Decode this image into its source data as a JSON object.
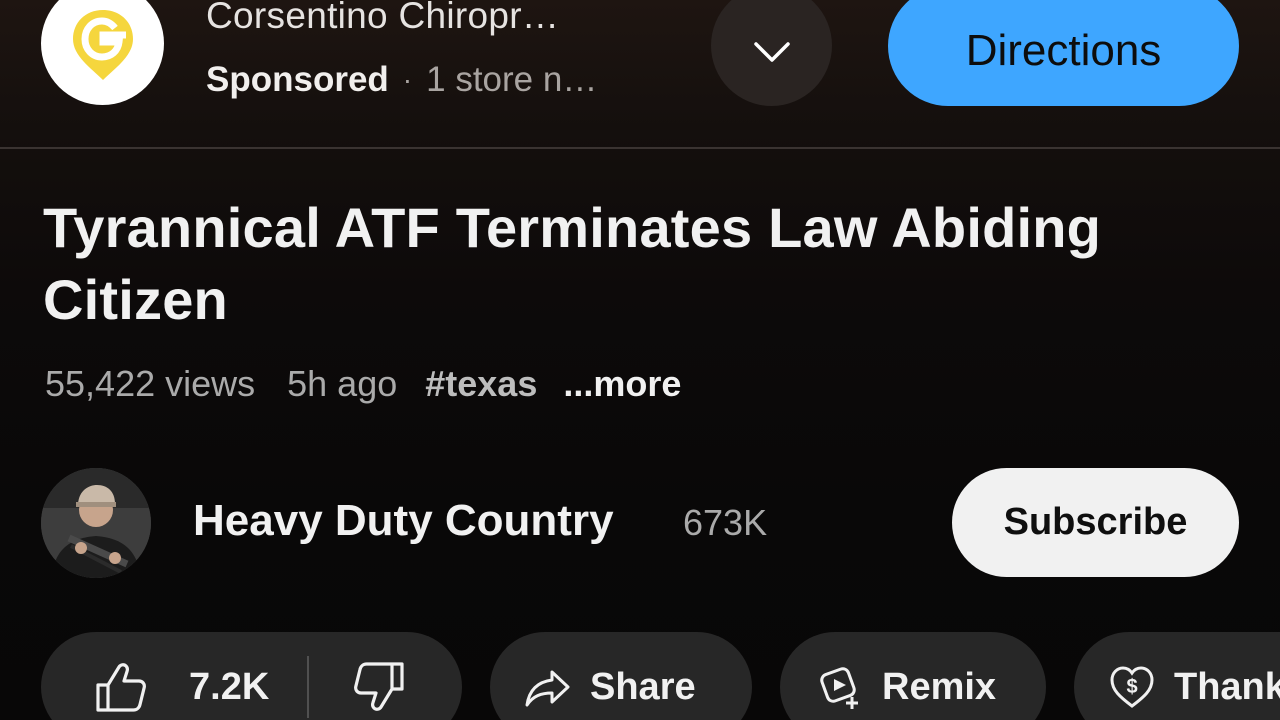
{
  "ad": {
    "title": "Corsentino Chiropr…",
    "sponsored": "Sponsored",
    "separator": "·",
    "store_info": "1 store n…",
    "directions_label": "Directions",
    "logo_icon": "location-pin-g-logo",
    "logo_color": "#f5d63d",
    "directions_color": "#3ea6ff"
  },
  "video": {
    "title": "Tyrannical ATF Terminates Law Abiding Citizen",
    "views": "55,422 views",
    "time": "5h ago",
    "hashtag": "#texas",
    "more": "...more"
  },
  "channel": {
    "name": "Heavy Duty Country",
    "subscribers": "673K",
    "subscribe_label": "Subscribe"
  },
  "actions": {
    "like_count": "7.2K",
    "share_label": "Share",
    "remix_label": "Remix",
    "thanks_label": "Thanks"
  }
}
